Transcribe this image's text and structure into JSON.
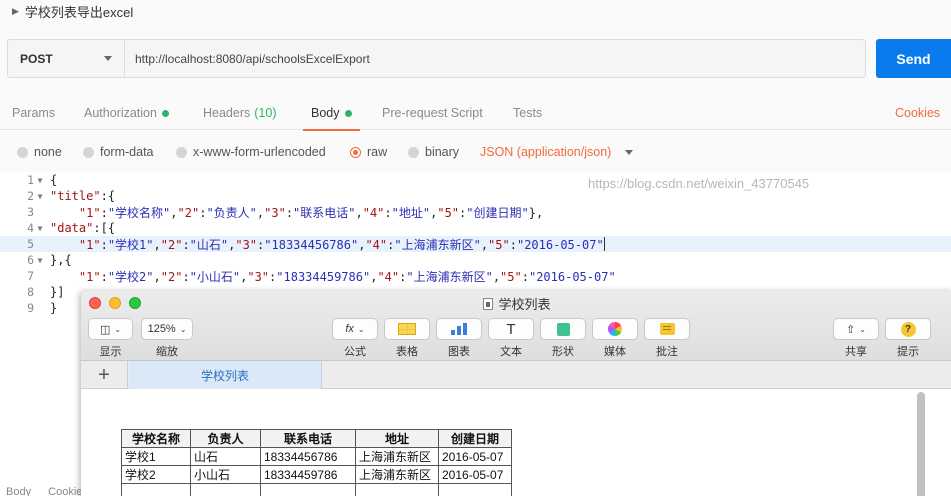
{
  "request": {
    "name": "学校列表导出excel",
    "method": "POST",
    "url": "http://localhost:8080/api/schoolsExcelExport",
    "send_label": "Send"
  },
  "tabs": [
    {
      "label": "Params"
    },
    {
      "label": "Authorization"
    },
    {
      "label": "Headers",
      "count": "(10)"
    },
    {
      "label": "Body"
    },
    {
      "label": "Pre-request Script"
    },
    {
      "label": "Tests"
    }
  ],
  "cookies_label": "Cookies",
  "body_types": [
    "none",
    "form-data",
    "x-www-form-urlencoded",
    "raw",
    "binary"
  ],
  "content_type": "JSON (application/json)",
  "editor": {
    "line_numbers": [
      "1",
      "2",
      "3",
      "4",
      "5",
      "6",
      "7",
      "8",
      "9"
    ],
    "lines": [
      "{",
      "\"title\":{",
      "    \"1\":\"学校名称\",\"2\":\"负责人\",\"3\":\"联系电话\",\"4\":\"地址\",\"5\":\"创建日期\"},",
      "\"data\":[{",
      "    \"1\":\"学校1\",\"2\":\"山石\",\"3\":\"18334456786\",\"4\":\"上海浦东新区\",\"5\":\"2016-05-07\"",
      "},{",
      "    \"1\":\"学校2\",\"2\":\"小山石\",\"3\":\"18334459786\",\"4\":\"上海浦东新区\",\"5\":\"2016-05-07\"",
      "}]",
      "}"
    ]
  },
  "footer_tabs": [
    "Body",
    "Cookie"
  ],
  "numbers": {
    "window_title": "学校列表",
    "toolbar": {
      "view": "显示",
      "zoom_value": "125%",
      "zoom": "缩放",
      "formula_icon": "fx",
      "formula": "公式",
      "table": "表格",
      "chart": "图表",
      "text_icon": "T",
      "text": "文本",
      "shape": "形状",
      "media": "媒体",
      "comment": "批注",
      "share": "共享",
      "tips": "提示"
    },
    "sheet_tab": "学校列表",
    "table": {
      "headers": [
        "学校名称",
        "负责人",
        "联系电话",
        "地址",
        "创建日期"
      ],
      "rows": [
        [
          "学校1",
          "山石",
          "18334456786",
          "上海浦东新区",
          "2016-05-07"
        ],
        [
          "学校2",
          "小山石",
          "18334459786",
          "上海浦东新区",
          "2016-05-07"
        ],
        [
          "",
          "",
          "",
          "",
          ""
        ]
      ]
    },
    "watermark": "https://blog.csdn.net/weixin_43770545"
  }
}
